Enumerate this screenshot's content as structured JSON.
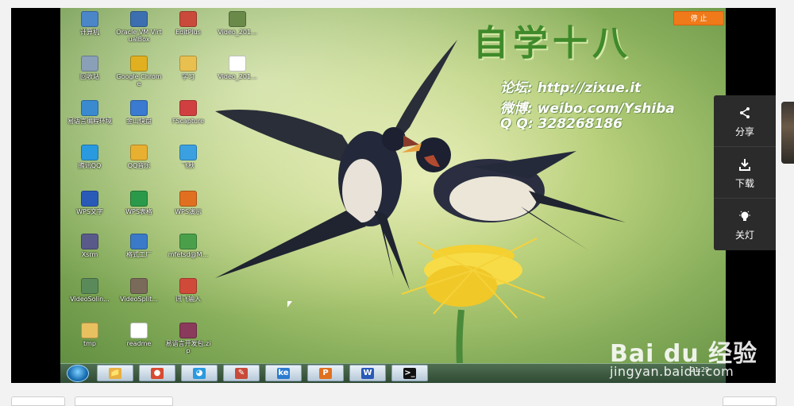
{
  "desktop": {
    "icons": [
      {
        "label": "计算机",
        "color": "#4a86c8"
      },
      {
        "label": "Oracle VM VirtualBox",
        "color": "#3b6fb0"
      },
      {
        "label": "EditPlus",
        "color": "#c94a3a"
      },
      {
        "label": "Video_201...",
        "color": "#6a8a4a"
      },
      {
        "label": "回收站",
        "color": "#8aa0b8"
      },
      {
        "label": "Google Chrome",
        "color": "#e0b020"
      },
      {
        "label": "学习",
        "color": "#e8c050"
      },
      {
        "label": "Video_201...",
        "color": "#ffffff"
      },
      {
        "label": "易语言编程环境",
        "color": "#3a8ad0"
      },
      {
        "label": "金山快盘",
        "color": "#3a7ad0"
      },
      {
        "label": "FScapture",
        "color": "#d04040"
      },
      {
        "label": "腾讯QQ",
        "color": "#2a9ae0"
      },
      {
        "label": "QQ音乐",
        "color": "#e8b030"
      },
      {
        "label": "飞秋",
        "color": "#3aa0e0"
      },
      {
        "label": "WPS文字",
        "color": "#2a5ab8"
      },
      {
        "label": "WPS表格",
        "color": "#2a9a4a"
      },
      {
        "label": "WPS演示",
        "color": "#e07020"
      },
      {
        "label": "Xsrm",
        "color": "#5a5a8a"
      },
      {
        "label": "格式工厂",
        "color": "#3a7ac8"
      },
      {
        "label": "mfetsd@M...",
        "color": "#4aa04a"
      },
      {
        "label": "VideoSolin...",
        "color": "#5a8a5a"
      },
      {
        "label": "VideoSplit...",
        "color": "#7a6a5a"
      },
      {
        "label": "讯飞输入",
        "color": "#d04a3a"
      },
      {
        "label": "tmp",
        "color": "#e8c060"
      },
      {
        "label": "readme",
        "color": "#ffffff"
      },
      {
        "label": "易语言开发包.zip",
        "color": "#8a3a5a"
      }
    ]
  },
  "video_overlay": {
    "stop_label": "停 止",
    "brand": "自学十八",
    "forum_line": "论坛: http://zixue.it",
    "weibo_line": "微博: weibo.com/Yshiba",
    "qq_line": "Q Q: 328268186"
  },
  "taskbar": {
    "apps": [
      {
        "name": "explorer",
        "glyph": "📁",
        "color": "#e8b040"
      },
      {
        "name": "chrome",
        "glyph": "●",
        "color": "#d84a30"
      },
      {
        "name": "qq",
        "glyph": "◕",
        "color": "#2a9ae0"
      },
      {
        "name": "editplus",
        "glyph": "✎",
        "color": "#c94a3a"
      },
      {
        "name": "ke",
        "glyph": "ke",
        "color": "#2a7ad0"
      },
      {
        "name": "wps-present",
        "glyph": "P",
        "color": "#e07020"
      },
      {
        "name": "wps-writer",
        "glyph": "W",
        "color": "#2a5ab8"
      },
      {
        "name": "cmd",
        "glyph": ">_",
        "color": "#111111"
      }
    ],
    "clock": "21:29"
  },
  "side_panel": {
    "share_label": "分享",
    "download_label": "下载",
    "lights_label": "关灯"
  },
  "watermark": {
    "main": "Bai du 经验",
    "url": "jingyan.baidu.com"
  }
}
